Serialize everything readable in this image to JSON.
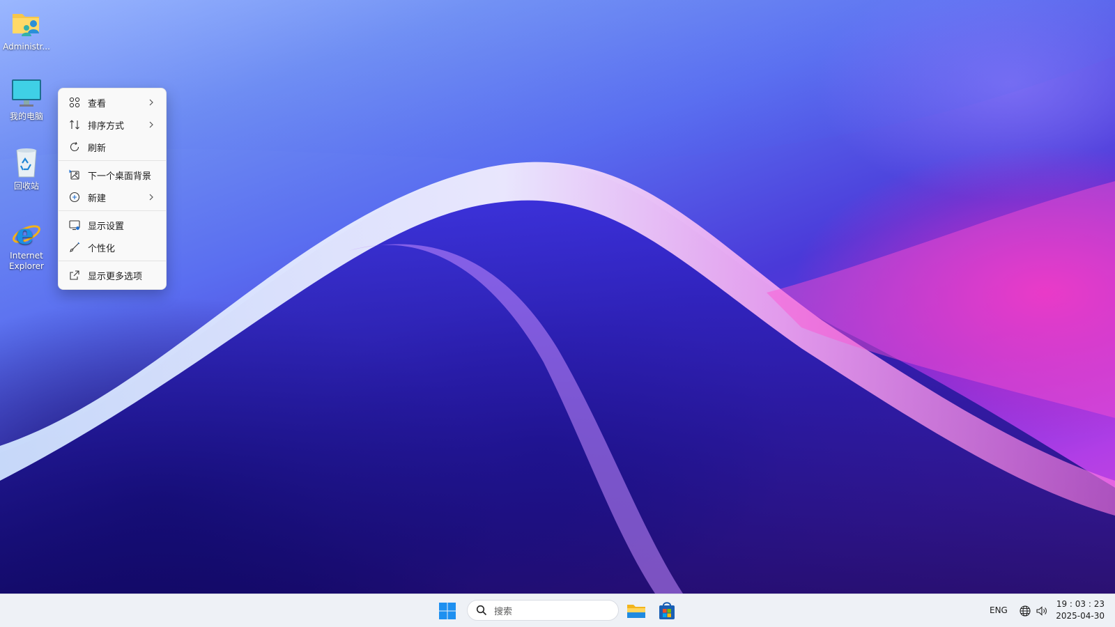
{
  "desktop": {
    "icons": [
      {
        "label": "Administr...",
        "icon": "user-folder-icon"
      },
      {
        "label": "我的电脑",
        "icon": "monitor-icon"
      },
      {
        "label": "回收站",
        "icon": "recycle-bin-icon"
      },
      {
        "label": "Internet Explorer",
        "icon": "internet-explorer-icon"
      }
    ]
  },
  "context_menu": {
    "items": [
      {
        "label": "查看",
        "icon": "grid-view-icon",
        "submenu": true
      },
      {
        "label": "排序方式",
        "icon": "sort-icon",
        "submenu": true
      },
      {
        "label": "刷新",
        "icon": "refresh-icon",
        "submenu": false
      },
      {
        "label": "下一个桌面背景",
        "icon": "next-background-icon",
        "submenu": false
      },
      {
        "label": "新建",
        "icon": "new-plus-icon",
        "submenu": true
      },
      {
        "label": "显示设置",
        "icon": "display-settings-icon",
        "submenu": false
      },
      {
        "label": "个性化",
        "icon": "brush-icon",
        "submenu": false
      },
      {
        "label": "显示更多选项",
        "icon": "more-options-icon",
        "submenu": false
      }
    ]
  },
  "taskbar": {
    "search_placeholder": "搜索",
    "apps": [
      {
        "name": "file-explorer",
        "icon": "folder-icon"
      },
      {
        "name": "microsoft-store",
        "icon": "store-icon"
      }
    ],
    "tray": {
      "language": "ENG",
      "time": "19 : 03 : 23",
      "date": "2025-04-30"
    }
  },
  "colors": {
    "accent": "#0078d4",
    "menu_bg": "#f9f9f9",
    "taskbar_bg": "#eef1f6"
  }
}
